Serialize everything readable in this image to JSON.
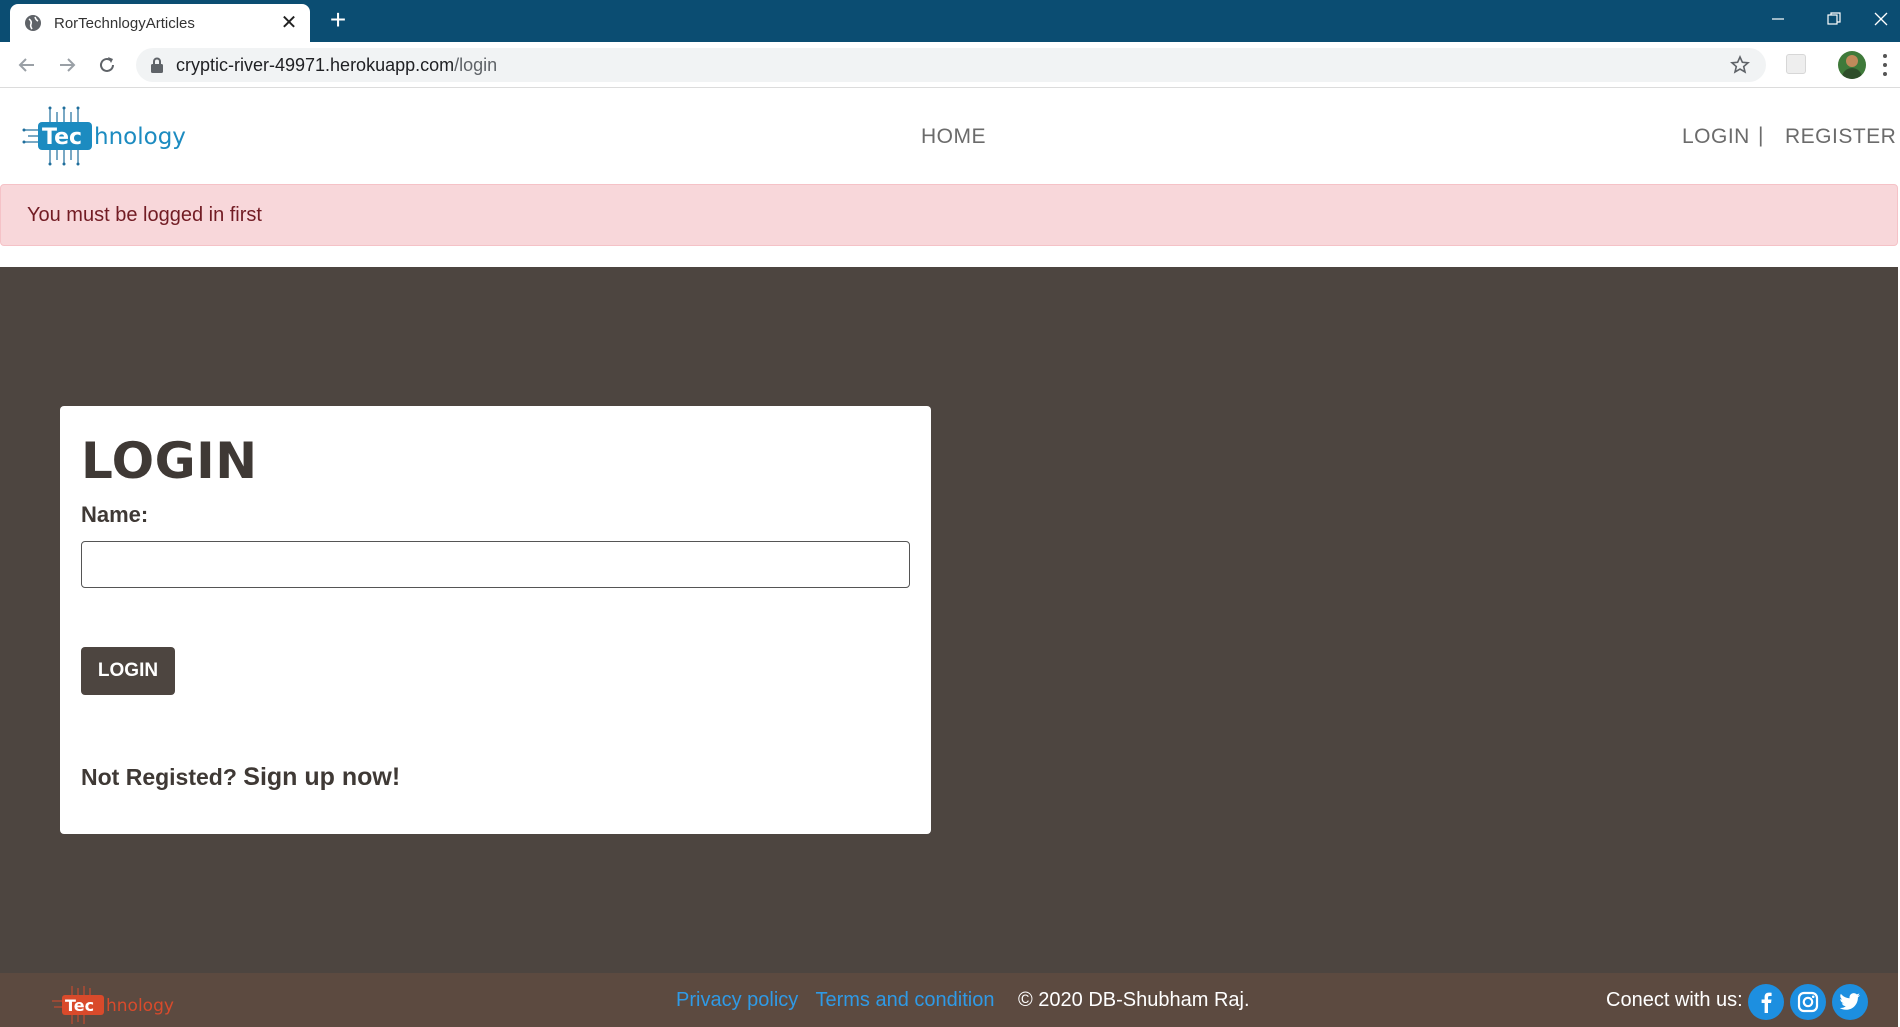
{
  "browser": {
    "tab_title": "RorTechnlogyArticles",
    "url_host": "cryptic-river-49971.herokuapp.com",
    "url_path": "/login",
    "accent": "#0b4d72"
  },
  "header": {
    "logo_text_box": "Tec",
    "logo_text_rest": "hnology",
    "nav": {
      "home": "HOME",
      "login": "LOGIN",
      "separator": "|",
      "register": "REGISTER"
    }
  },
  "alert": {
    "message": "You must be logged in first",
    "bg_color": "#f8d7da"
  },
  "login_form": {
    "title": "LOGIN",
    "name_label": "Name:",
    "name_value": "",
    "submit_label": "LOGIN",
    "signup_prefix": "Not Registed?",
    "signup_link": "Sign up now!"
  },
  "footer": {
    "links": [
      "Privacy policy",
      "Terms and condition"
    ],
    "copyright": "© 2020 DB-Shubham Raj.",
    "connect_label": "Conect with us:",
    "social": [
      "facebook-icon",
      "instagram-icon",
      "twitter-icon"
    ],
    "link_color": "#2f9ae6",
    "bg_color": "#5c4a40"
  },
  "colors": {
    "main_bg": "#4d4540",
    "primary_text": "#3f3935"
  }
}
